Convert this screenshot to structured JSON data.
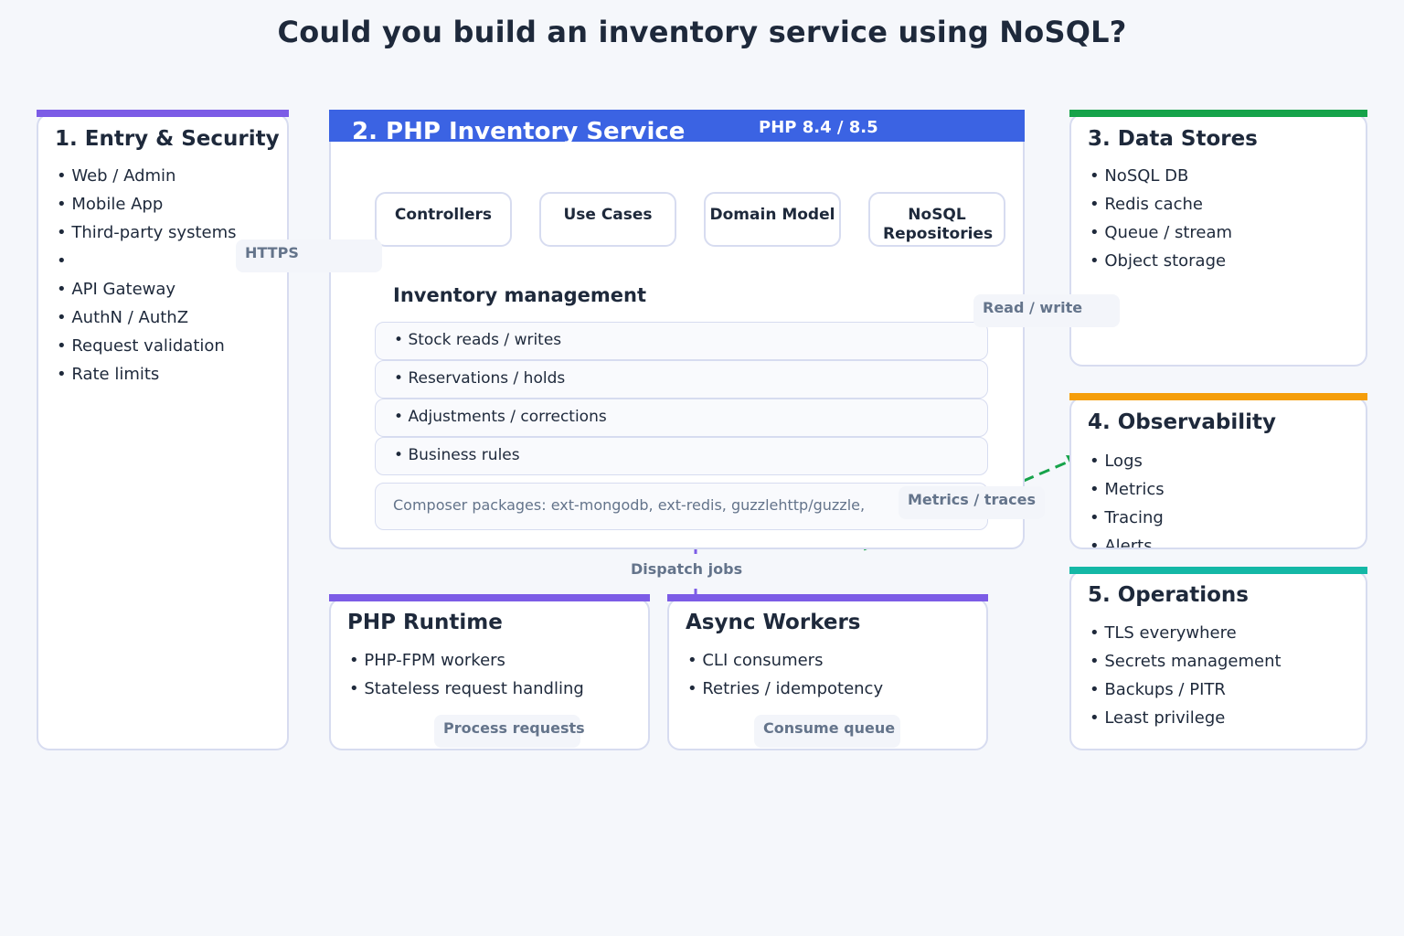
{
  "title": "Could you build an inventory service using NoSQL?",
  "entry": {
    "title": "1. Entry & Security",
    "items": [
      "Web / Admin",
      "Mobile App",
      "Third-party systems",
      "",
      "API Gateway",
      "AuthN / AuthZ",
      "Request validation",
      "Rate limits"
    ],
    "color": "#7c5ce6"
  },
  "service": {
    "title": "2. PHP Inventory Service",
    "version": "PHP 8.4 / 8.5",
    "color": "#3b63e3",
    "components": [
      "Controllers",
      "Use Cases",
      "Domain Model",
      "NoSQL Repositories"
    ],
    "management_title": "Inventory management",
    "management_items": [
      "Stock reads / writes",
      "Reservations / holds",
      "Adjustments / corrections",
      "Business rules"
    ],
    "packages": "Composer packages: ext-mongodb, ext-redis, guzzlehttp/guzzle,"
  },
  "data_stores": {
    "title": "3. Data Stores",
    "items": [
      "NoSQL DB",
      "Redis cache",
      "Queue / stream",
      "Object storage"
    ],
    "color": "#16a34a"
  },
  "observability": {
    "title": "4. Observability",
    "items": [
      "Logs",
      "Metrics",
      "Tracing",
      "Alerts"
    ],
    "color": "#f59e0b"
  },
  "operations": {
    "title": "5. Operations",
    "items": [
      "TLS everywhere",
      "Secrets management",
      "Backups / PITR",
      "Least privilege"
    ],
    "color": "#14b8a6"
  },
  "runtime": {
    "title": "PHP Runtime",
    "items": [
      "PHP-FPM workers",
      "Stateless request handling"
    ],
    "color": "#7c5ce6"
  },
  "workers": {
    "title": "Async Workers",
    "items": [
      "CLI consumers",
      "Retries / idempotency"
    ],
    "color": "#7c5ce6"
  },
  "edges": {
    "https": "HTTPS",
    "read_write": "Read / write",
    "metrics": "Metrics / traces",
    "dispatch": "Dispatch jobs",
    "process": "Process requests",
    "consume": "Consume queue"
  }
}
